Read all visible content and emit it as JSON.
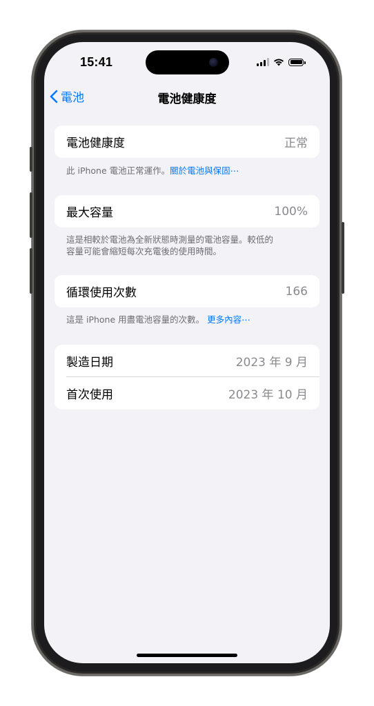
{
  "status_bar": {
    "time": "15:41"
  },
  "nav": {
    "back_label": "電池",
    "title": "電池健康度"
  },
  "health": {
    "label": "電池健康度",
    "value": "正常",
    "note": "此 iPhone 電池正常運作。",
    "link": "關於電池與保固⋯"
  },
  "max_capacity": {
    "label": "最大容量",
    "value": "100%",
    "note_line1": "這是相較於電池為全新狀態時測量的電池容量。較低的",
    "note_line2": "容量可能會縮短每次充電後的使用時間。"
  },
  "cycle_count": {
    "label": "循環使用次數",
    "value": "166",
    "note": "這是 iPhone 用盡電池容量的次數。",
    "link": "更多內容⋯"
  },
  "dates": {
    "manufacture_label": "製造日期",
    "manufacture_value": "2023 年 9 月",
    "first_use_label": "首次使用",
    "first_use_value": "2023 年 10 月"
  },
  "colors": {
    "accent": "#007aff",
    "background": "#f2f2f7",
    "secondary_text": "#8a8a8e"
  }
}
